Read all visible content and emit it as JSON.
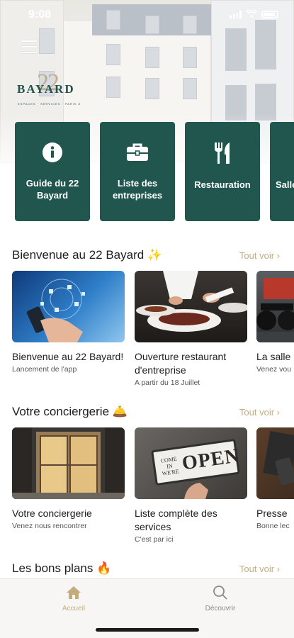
{
  "status_bar": {
    "time": "9:08"
  },
  "brand": {
    "logo_number": "22",
    "logo_word": "BAYARD",
    "logo_tagline": "ESPACES · SERVICES · PARIS 8"
  },
  "tiles": [
    {
      "label": "Guide du 22 Bayard",
      "icon": "info-icon"
    },
    {
      "label": "Liste des entreprises",
      "icon": "briefcase-icon"
    },
    {
      "label": "Restauration",
      "icon": "utensils-icon"
    },
    {
      "label": "Salle",
      "icon": ""
    }
  ],
  "sections": [
    {
      "title": "Bienvenue au 22 Bayard ✨",
      "see_all": "Tout voir ›",
      "cards": [
        {
          "title": "Bienvenue au 22 Bayard!",
          "subtitle": "Lancement de l'app"
        },
        {
          "title": "Ouverture restaurant d'entreprise",
          "subtitle": "A partir du 18 Juillet"
        },
        {
          "title": "La salle",
          "subtitle": "Venez vou"
        }
      ]
    },
    {
      "title": "Votre conciergerie 🛎️",
      "see_all": "Tout voir ›",
      "cards": [
        {
          "title": "Votre conciergerie",
          "subtitle": "Venez nous rencontrer"
        },
        {
          "title": "Liste complète des services",
          "subtitle": "C'est par ici",
          "sign_small": "COME IN WE'RE",
          "sign_big": "OPEN"
        },
        {
          "title": "Presse",
          "subtitle": "Bonne lec"
        }
      ]
    },
    {
      "title": "Les bons plans 🔥",
      "see_all": "Tout voir ›"
    }
  ],
  "tabbar": [
    {
      "label": "Accueil",
      "icon": "home-icon",
      "active": true
    },
    {
      "label": "Découvrir",
      "icon": "search-icon",
      "active": false
    }
  ],
  "colors": {
    "primary": "#21564e",
    "accent": "#c4ad7c",
    "text": "#1d1d1d"
  }
}
